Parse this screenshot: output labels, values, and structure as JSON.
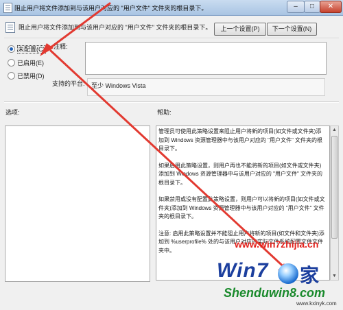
{
  "window": {
    "title": "阻止用户将文件添加到与该用户对应的 \"用户文件\" 文件夹的根目录下。",
    "minimize_label": "–",
    "maximize_label": "□",
    "close_label": "✕"
  },
  "header": {
    "policy_name": "阻止用户将文件添加到与该用户对应的 \"用户文件\" 文件夹的根目录下。",
    "prev_button": "上一个设置(P)",
    "next_button": "下一个设置(N)"
  },
  "state_options": [
    {
      "label": "未配置(C)",
      "selected": true
    },
    {
      "label": "已启用(E)",
      "selected": false
    },
    {
      "label": "已禁用(D)",
      "selected": false
    }
  ],
  "comment": {
    "label": "注释:",
    "value": ""
  },
  "supported_on": {
    "label": "支持的平台:",
    "value": "至少 Windows Vista"
  },
  "options": {
    "label": "选项:"
  },
  "help": {
    "label": "帮助:",
    "paragraphs": [
      "管理员可使用此策略设置来阻止用户将新的项目(如文件或文件夹)添加到 Windows 资源管理器中与该用户对应的 \"用户文件\" 文件夹的根目录下。",
      "如果启用此策略设置，则用户再也不能将新的项目(如文件或文件夹)添加到 Windows 资源管理器中与该用户对应的 \"用户文件\" 文件夹的根目录下。",
      "如果禁用或没有配置此策略设置，则用户可以将新的项目(如文件或文件夹)添加到 Windows 资源管理器中与该用户对应的 \"用户文件\" 文件夹的根目录下。",
      "注意: 启用此策略设置并不能阻止用户将新的项目(如文件和文件夹)添加到 %userprofile% 处的与该用户对应的实际文件系统配置文件文件夹中。"
    ]
  },
  "watermark": {
    "url": "www.win7zhijia.cn",
    "logo": "Win7",
    "logo_char": "家",
    "site": "Shenduwin8.com",
    "small": "www.kxinyk.com"
  },
  "colors": {
    "annotation_arrow": "#e23a31",
    "title_bar": "#b9d0ea",
    "dialog_bg": "#f0f0f0"
  }
}
